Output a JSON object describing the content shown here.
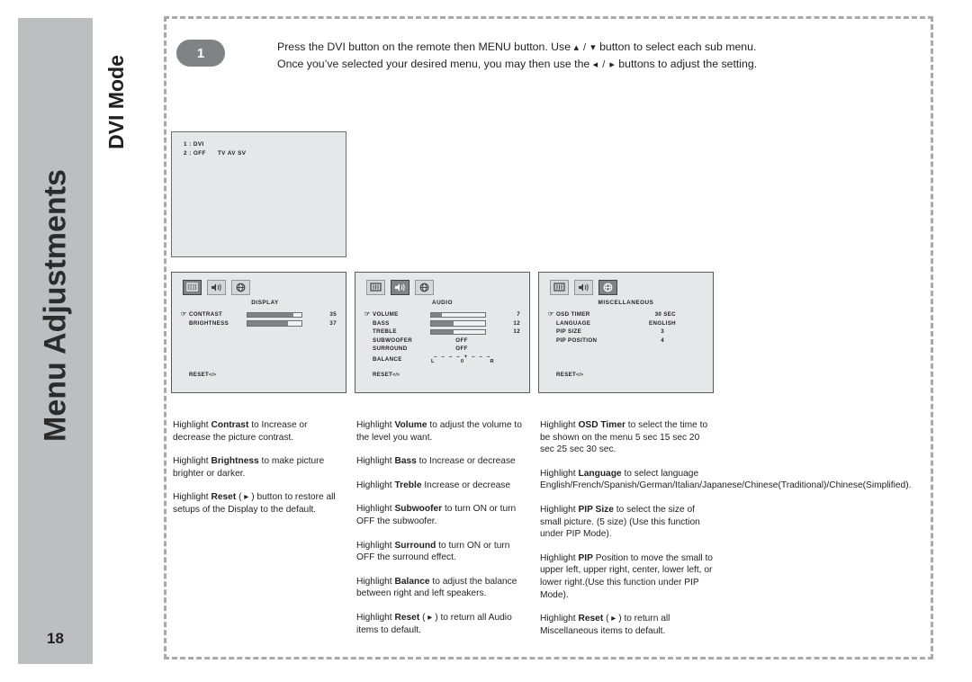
{
  "sidebar": {
    "title": "Menu Adjustments",
    "page_number": "18"
  },
  "chapter": {
    "label": "DVI Mode"
  },
  "step": {
    "number": "1",
    "line1_a": "Press the DVI button on the remote then MENU button. Use ",
    "line1_arrows": "▴ / ▾",
    "line1_b": "  button to select each sub menu.",
    "line2_a": "Once you’ve selected your desired menu, you may then use the ",
    "line2_arrows": "◂ / ▸",
    "line2_b": "  buttons to adjust the setting."
  },
  "tv_preview": {
    "line1": "1 : DVI",
    "line2_label": "2 : OFF",
    "line2_sources": "TV AV SV"
  },
  "osd_panels": [
    {
      "id": "display",
      "title": "DISPLAY",
      "selected_icon": 0,
      "icons": [
        "monitor-icon",
        "speaker-icon",
        "globe-icon"
      ],
      "rows": [
        {
          "label": "CONTRAST",
          "type": "bar",
          "fill": 85,
          "value": "35",
          "cursor": true
        },
        {
          "label": "BRIGHTNESS",
          "type": "bar",
          "fill": 75,
          "value": "37",
          "cursor": false
        }
      ],
      "reset": "RESET",
      "reset_arrows": "</>"
    },
    {
      "id": "audio",
      "title": "AUDIO",
      "selected_icon": 1,
      "icons": [
        "monitor-icon",
        "speaker-icon",
        "globe-icon"
      ],
      "rows": [
        {
          "label": "VOLUME",
          "type": "bar",
          "fill": 20,
          "value": "7",
          "cursor": true
        },
        {
          "label": "BASS",
          "type": "bar",
          "fill": 42,
          "value": "12",
          "cursor": false
        },
        {
          "label": "TREBLE",
          "type": "bar",
          "fill": 42,
          "value": "12",
          "cursor": false
        },
        {
          "label": "SUBWOOFER",
          "type": "text",
          "value": "OFF",
          "cursor": false
        },
        {
          "label": "SURROUND",
          "type": "text",
          "value": "OFF",
          "cursor": false
        },
        {
          "label": "BALANCE",
          "type": "balance",
          "ticks": "– – – – + – – –",
          "left": "L",
          "center": "0",
          "right": "R",
          "cursor": false
        }
      ],
      "reset": "RESET",
      "reset_arrows": "</>"
    },
    {
      "id": "miscellaneous",
      "title": "MISCELLANEOUS",
      "selected_icon": 2,
      "icons": [
        "monitor-icon",
        "speaker-icon",
        "globe-icon"
      ],
      "rows": [
        {
          "label": "OSD TIMER",
          "type": "text",
          "value": "30 SEC",
          "cursor": true
        },
        {
          "label": "LANGUAGE",
          "type": "text",
          "value": "ENGLISH",
          "cursor": false
        },
        {
          "label": "PIP SIZE",
          "type": "num",
          "value": "3",
          "cursor": false
        },
        {
          "label": "PIP POSITION",
          "type": "num",
          "value": "4",
          "cursor": false
        }
      ],
      "reset": "RESET",
      "reset_arrows": "</>"
    }
  ],
  "descriptions": {
    "column1": [
      {
        "pre": "Highlight ",
        "bold": "Contrast",
        "post": " to Increase or decrease the picture contrast."
      },
      {
        "pre": "Highlight ",
        "bold": "Brightness",
        "post": " to make picture brighter or darker."
      },
      {
        "pre": "Highlight ",
        "bold": "Reset",
        "post": " ( ▸ ) button to restore all setups of the Display to the default."
      }
    ],
    "column2": [
      {
        "pre": "Highlight ",
        "bold": "Volume",
        "post": " to adjust the volume to the level you want."
      },
      {
        "pre": "Highlight ",
        "bold": "Bass",
        "post": " to Increase or decrease"
      },
      {
        "pre": "Highlight ",
        "bold": "Treble",
        "post": " Increase or decrease"
      },
      {
        "pre": "Highlight ",
        "bold": "Subwoofer",
        "post": " to turn ON or turn OFF the subwoofer."
      },
      {
        "pre": "Highlight ",
        "bold": "Surround",
        "post": " to turn ON or turn OFF the surround effect."
      },
      {
        "pre": "Highlight ",
        "bold": "Balance",
        "post": " to adjust the balance between right and left speakers."
      },
      {
        "pre": "Highlight ",
        "bold": "Reset",
        "post": " ( ▸ ) to return all Audio items to default."
      }
    ],
    "column3": [
      {
        "pre": "Highlight ",
        "bold": "OSD Timer",
        "post": " to select the time to be shown on the menu 5 sec 15 sec 20 sec 25 sec 30 sec."
      },
      {
        "pre": "Highlight ",
        "bold": "Language",
        "post": " to select language English/French/Spanish/German/Italian/Japanese/Chinese(Traditional)/Chinese(Simplified)."
      },
      {
        "pre": "Highlight ",
        "bold": "PIP Size",
        "post": " to select the size of small picture. (5 size) (Use this function under PIP Mode)."
      },
      {
        "pre": "Highlight ",
        "bold": "PIP",
        "post": " Position to move the small to upper left, upper right, center, lower left, or lower right.(Use this function under PIP Mode)."
      },
      {
        "pre": "Highlight ",
        "bold": "Reset",
        "post": " ( ▸ ) to return all Miscellaneous items to default."
      }
    ]
  },
  "colors": {
    "band": "#bcbec0",
    "badge": "#808285",
    "frame_dash": "#a7a9ac",
    "osd_bg": "#e6e7e8",
    "bar_fill": "#808285",
    "text": "#231f20"
  }
}
